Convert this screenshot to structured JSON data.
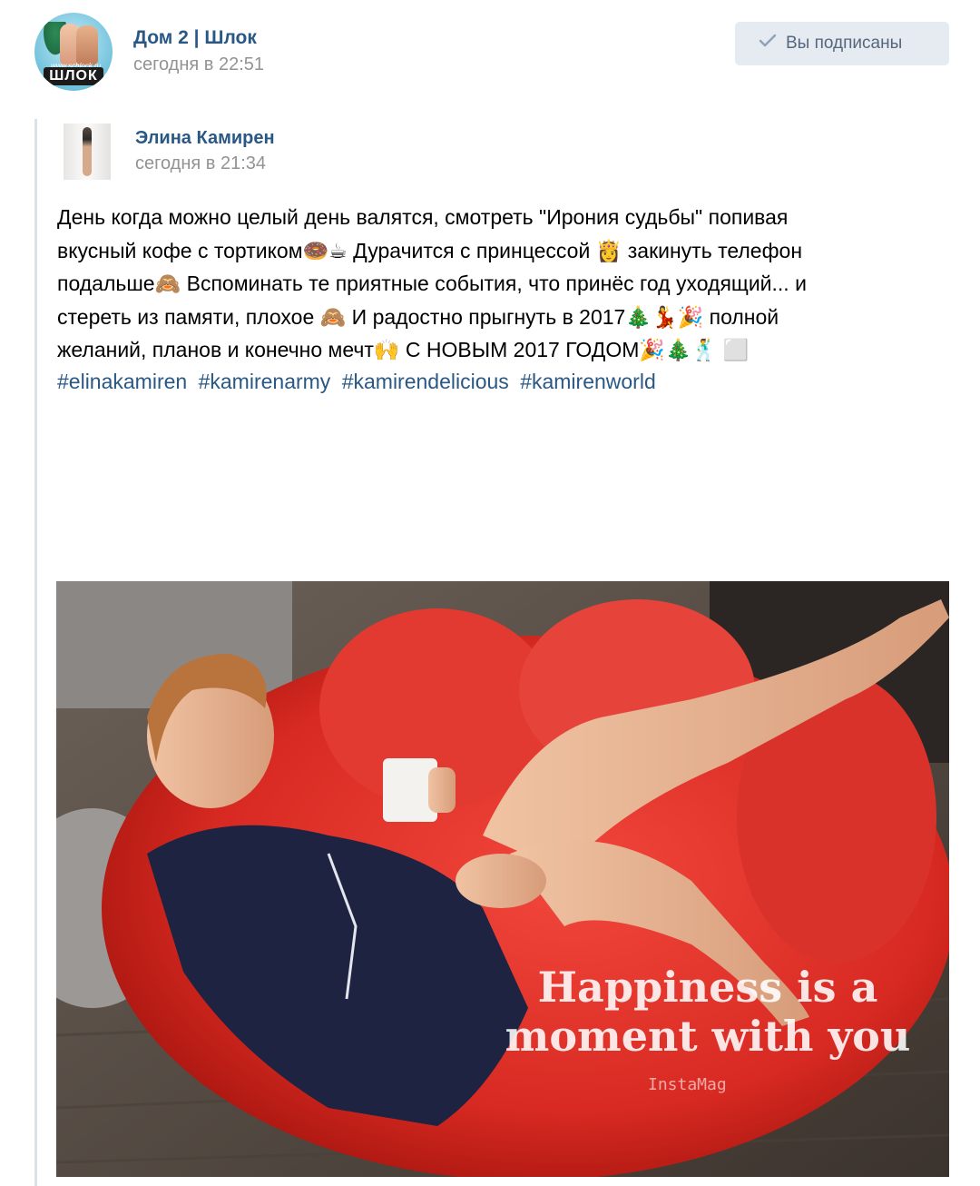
{
  "group": {
    "name": "Дом 2 | Шлок",
    "time": "сегодня в 22:51",
    "avatar_icon": "group-avatar-shlok",
    "avatar_site": "www.schlock.ru",
    "avatar_badge": "ШЛОК"
  },
  "subscribe_button": {
    "label": "Вы подписаны",
    "icon": "check-icon"
  },
  "repost": {
    "author_name": "Элина Камирен",
    "time": "сегодня в 21:34",
    "text_lines": [
      "День когда можно целый день валятся, смотреть \"Ирония судьбы\" попивая",
      "вкусный кофе с тортиком🍩☕ Дурачится с принцессой 👸 закинуть телефон",
      "подальше🙈 Вспоминать те приятные события, что принёс год уходящий... и",
      "стереть из памяти, плохое 🙈 И радостно прыгнуть в 2017🎄💃🎉 полной",
      "желаний, планов и конечно мечт🙌 С НОВЫМ 2017 ГОДОМ🎉🎄🕺 ⬜"
    ],
    "hashtags": [
      "#elinakamiren",
      "#kamirenarmy",
      "#kamirendelicious",
      "#kamirenworld"
    ]
  },
  "photo": {
    "caption_line1": "Happiness is a",
    "caption_line2": "moment with you",
    "watermark": "InstaMag"
  },
  "colors": {
    "link": "#2a5885",
    "meta": "#939393",
    "button_bg": "#e5ebf1",
    "button_text": "#55677d",
    "repost_bar": "#dae1e8"
  }
}
